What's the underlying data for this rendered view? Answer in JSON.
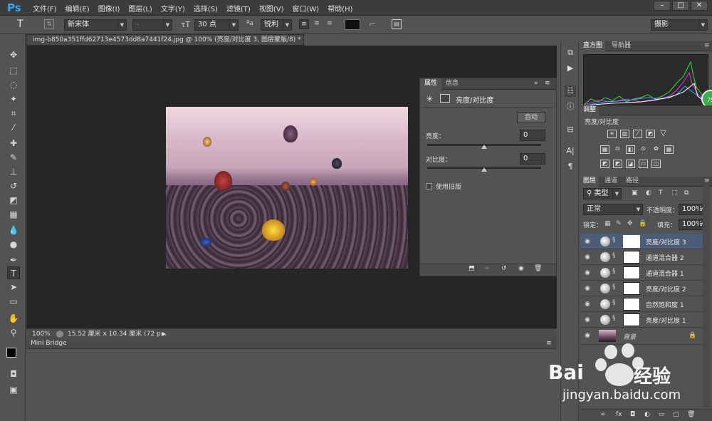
{
  "app": {
    "logo": "Ps"
  },
  "menu": [
    "文件(F)",
    "编辑(E)",
    "图像(I)",
    "图层(L)",
    "文字(Y)",
    "选择(S)",
    "滤镜(T)",
    "视图(V)",
    "窗口(W)",
    "帮助(H)"
  ],
  "window_controls": [
    "–",
    "□",
    "✕"
  ],
  "options": {
    "tool_glyph": "T",
    "font_family": "新宋体",
    "font_style": "-",
    "font_size": "30 点",
    "aa_label": "ªa",
    "antialias": "锐利",
    "workspace": "摄影"
  },
  "document": {
    "tab_title": "img-b850a351ffd62713e4573dd8a7441f24.jpg @ 100% (亮度/对比度 3, 图层蒙版/8) *",
    "zoom": "100%",
    "doc_info": "15.52 厘米 x 10.34 厘米 (72 p..."
  },
  "mini_bridge": {
    "title": "Mini Bridge"
  },
  "properties": {
    "tabs": [
      "属性",
      "信息"
    ],
    "adjustment_title": "亮度/对比度",
    "auto_button": "自动",
    "brightness_label": "亮度：",
    "brightness_value": "0",
    "contrast_label": "对比度：",
    "contrast_value": "0",
    "use_legacy": "使用旧版"
  },
  "right": {
    "top_tabs": [
      "直方图",
      "导航器"
    ],
    "adjust_tab": "调整",
    "adjust_title": "亮度/对比度",
    "layer_tabs": [
      "图层",
      "通道",
      "路径"
    ],
    "filter_kind": "类型",
    "blend_mode": "正常",
    "opacity_label": "不透明度：",
    "opacity_value": "100%",
    "lock_label": "锁定：",
    "fill_label": "填充：",
    "fill_value": "100%",
    "layers": [
      {
        "name": "亮度/对比度 3",
        "selected": true
      },
      {
        "name": "通道混合器 2",
        "selected": false
      },
      {
        "name": "通道混合器 1",
        "selected": false
      },
      {
        "name": "亮度/对比度 2",
        "selected": false
      },
      {
        "name": "自然饱和度 1",
        "selected": false
      },
      {
        "name": "亮度/对比度 1",
        "selected": false
      }
    ],
    "background_layer": "背景"
  },
  "watermark": {
    "brand": "Bai",
    "brand2": "经验",
    "url": "jingyan.baidu.com"
  },
  "badge": "75"
}
